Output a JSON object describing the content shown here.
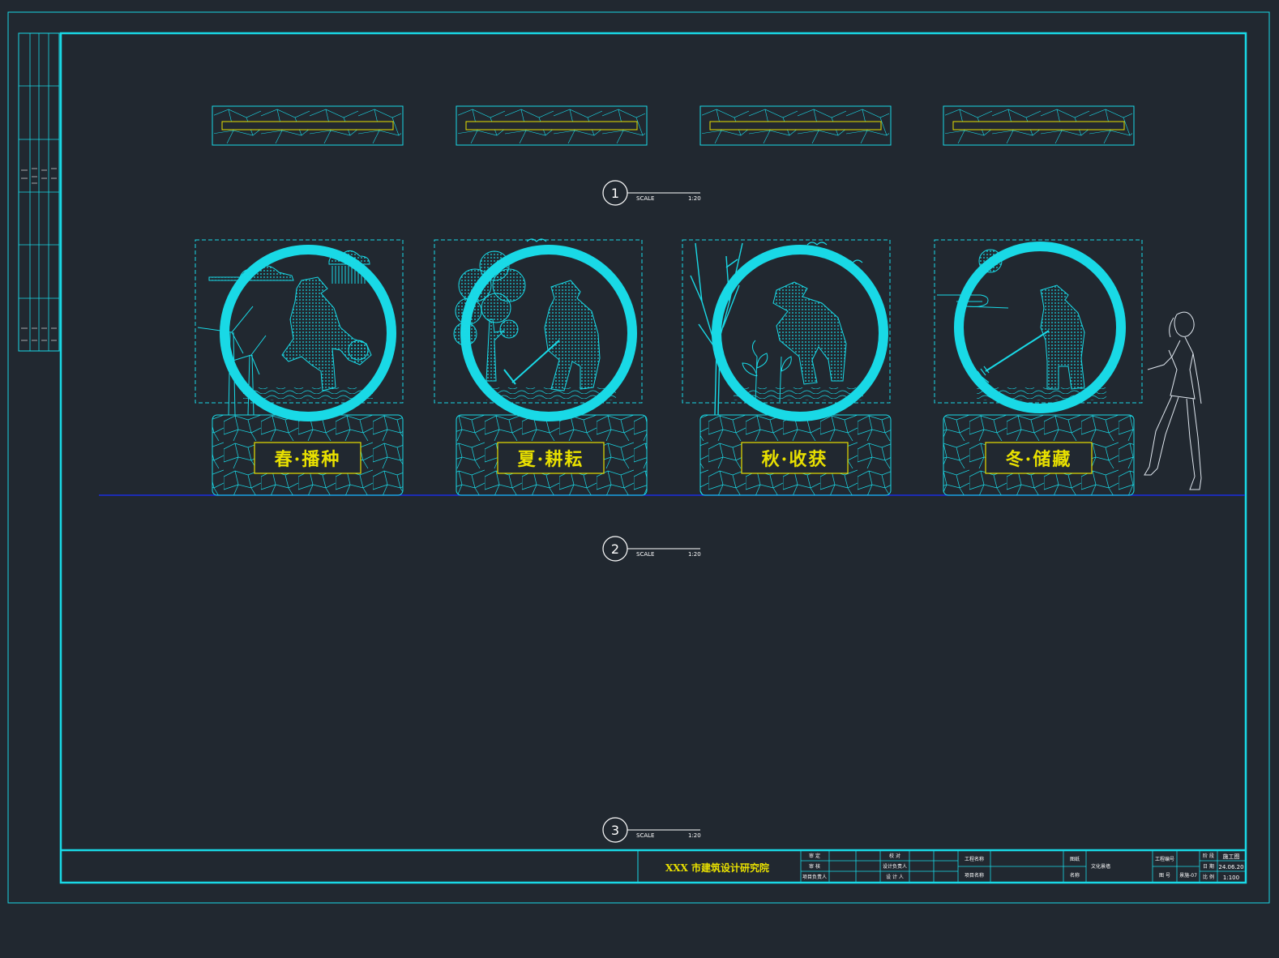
{
  "colors": {
    "background": "#212830",
    "line_cyan": "#19d9e6",
    "sign_yellow": "#e8e000",
    "ground_blue": "#1a2ee0",
    "text_white": "#ffffff"
  },
  "views": [
    {
      "number": "1",
      "scale_label": "SCALE",
      "scale_value": "1:20"
    },
    {
      "number": "2",
      "scale_label": "SCALE",
      "scale_value": "1:20"
    },
    {
      "number": "3",
      "scale_label": "SCALE",
      "scale_value": "1:20"
    }
  ],
  "panels": [
    {
      "season": "spring",
      "sign_text": "春·播种"
    },
    {
      "season": "summer",
      "sign_text": "夏·耕耘"
    },
    {
      "season": "autumn",
      "sign_text": "秋·收获"
    },
    {
      "season": "winter",
      "sign_text": "冬·储藏"
    }
  ],
  "title_block": {
    "institute": "XXX 市建筑设计研究院",
    "sign_rows": [
      [
        "审 定",
        "",
        "校 对",
        ""
      ],
      [
        "审 核",
        "",
        "设计负责人",
        ""
      ],
      [
        "项目负责人",
        "",
        "设 计 人",
        ""
      ]
    ],
    "project_name_label": "工程名称",
    "item_name_label": "项目名称",
    "drawing_label": "图纸",
    "drawing_name_label": "名称",
    "drawing_name_value": "文化景墙",
    "project_no_label": "工程编号",
    "drawing_no_label": "图 号",
    "drawing_no_value": "景施-07",
    "phase_label": "阶 段",
    "phase_value": "施工图",
    "date_label": "日 期",
    "date_value": "24.06.20",
    "scale_label": "比 例",
    "scale_value": "1:100"
  }
}
